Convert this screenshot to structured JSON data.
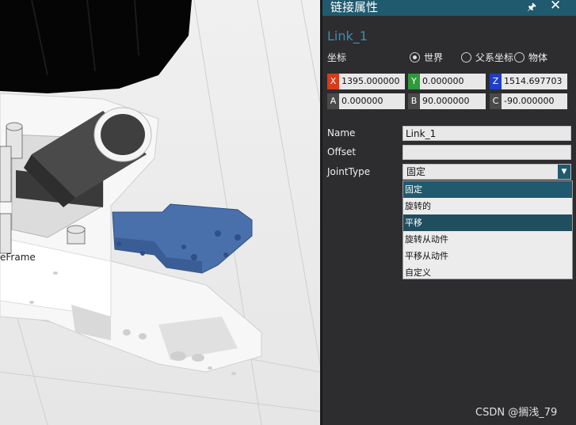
{
  "viewport": {
    "frame_label": "eFrame"
  },
  "panel": {
    "title": "链接属性",
    "pin_icon": "pin-icon",
    "close_icon": "close-icon",
    "link_name": "Link_1",
    "coordinate": {
      "label": "坐标",
      "options": [
        "世界",
        "父系坐标",
        "物体"
      ],
      "selected": "世界"
    },
    "coords": [
      {
        "tag": "X",
        "value": "1395.000000",
        "color": "#d83b1b"
      },
      {
        "tag": "Y",
        "value": "0.000000",
        "color": "#2e9a3a"
      },
      {
        "tag": "Z",
        "value": "1514.697703",
        "color": "#1f3fc4"
      },
      {
        "tag": "A",
        "value": "0.000000",
        "color": "#4a4a4a"
      },
      {
        "tag": "B",
        "value": "90.000000",
        "color": "#4a4a4a"
      },
      {
        "tag": "C",
        "value": "-90.000000",
        "color": "#4a4a4a"
      }
    ],
    "name_label": "Name",
    "name_value": "Link_1",
    "offset_label": "Offset",
    "offset_value": "",
    "jointtype_label": "JointType",
    "jointtype_value": "固定",
    "jointtype_options": [
      "固定",
      "旋转的",
      "平移",
      "旋转从动件",
      "平移从动件",
      "自定义"
    ],
    "selected_option": "固定",
    "hover_option": "平移"
  },
  "watermark": "CSDN @搁浅_79"
}
